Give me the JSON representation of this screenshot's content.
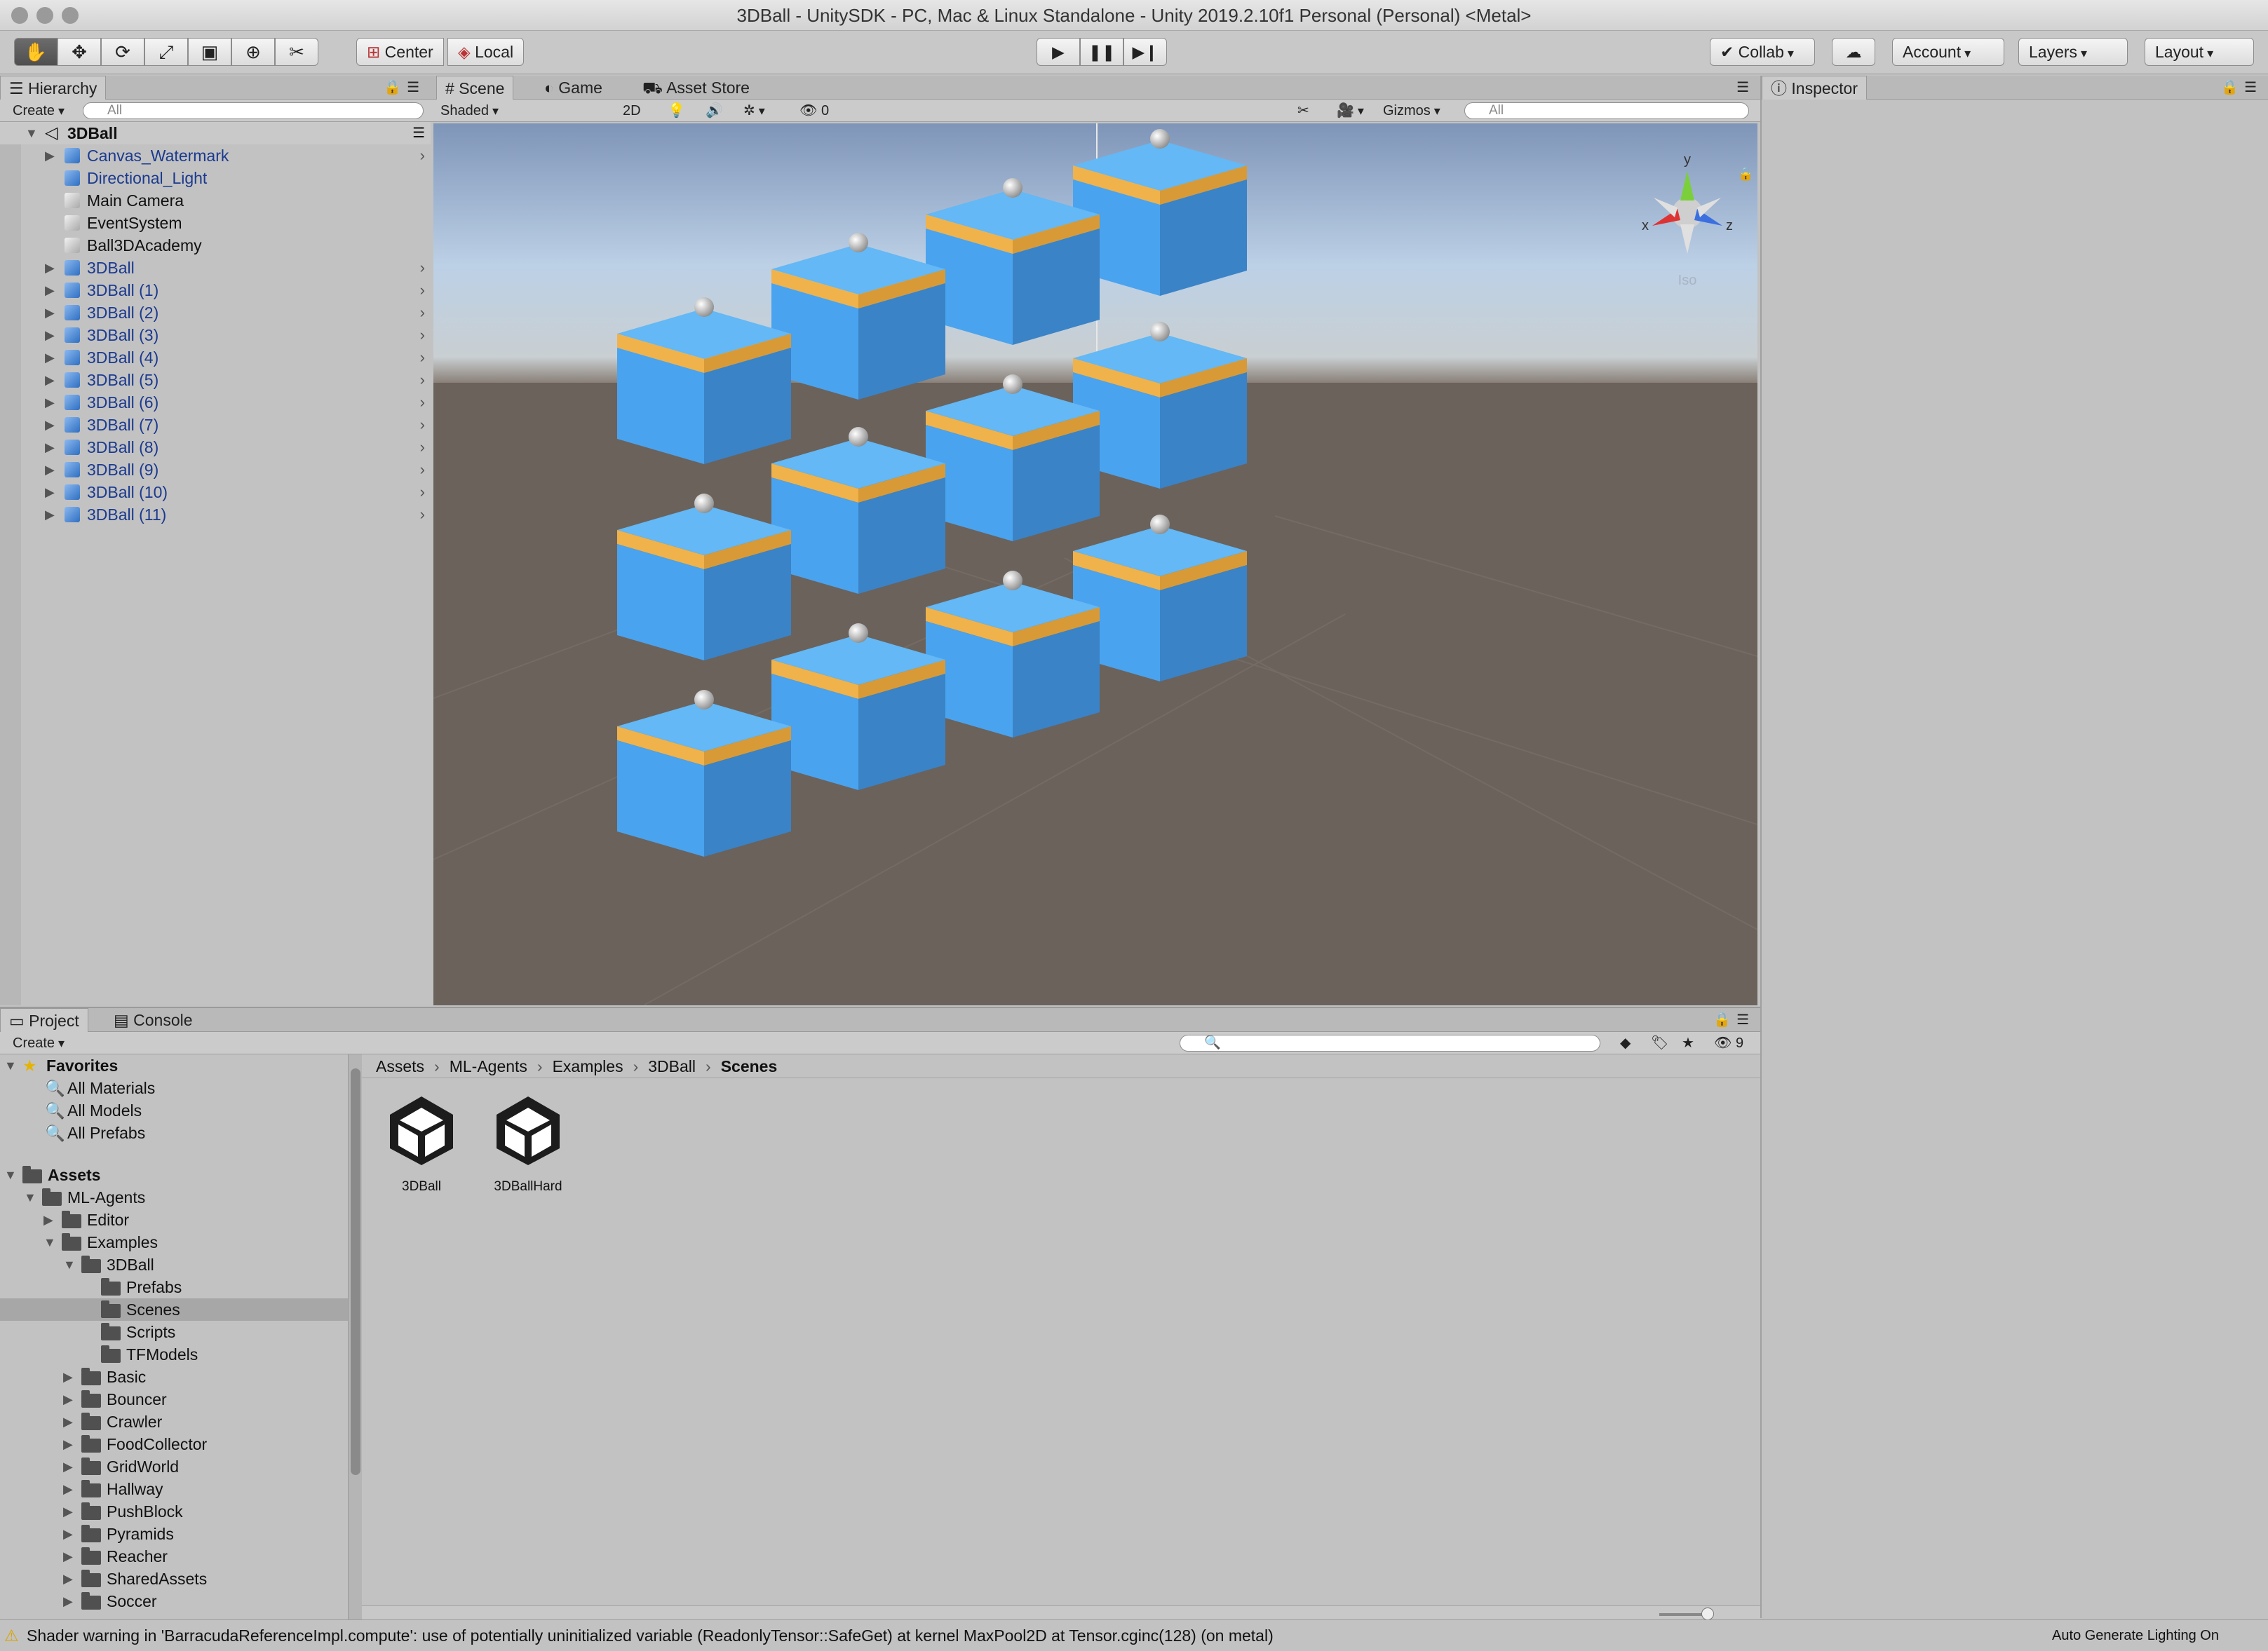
{
  "window": {
    "title": "3DBall - UnitySDK - PC, Mac & Linux Standalone - Unity 2019.2.10f1 Personal (Personal) <Metal>"
  },
  "toolbar": {
    "tools": [
      "hand-tool",
      "move-tool",
      "rotate-tool",
      "scale-tool",
      "rect-tool",
      "transform-tool",
      "custom-tool"
    ],
    "pivot_label": "Center",
    "space_label": "Local",
    "collab_label": "Collab",
    "account_label": "Account",
    "layers_label": "Layers",
    "layout_label": "Layout"
  },
  "hierarchy": {
    "tab_label": "Hierarchy",
    "create_label": "Create",
    "search_placeholder": "All",
    "scene_name": "3DBall",
    "items": [
      {
        "label": "Canvas_Watermark",
        "prefab": true,
        "expandable": true
      },
      {
        "label": "Directional_Light",
        "prefab": true,
        "expandable": false
      },
      {
        "label": "Main Camera",
        "prefab": false,
        "expandable": false
      },
      {
        "label": "EventSystem",
        "prefab": false,
        "expandable": false
      },
      {
        "label": "Ball3DAcademy",
        "prefab": false,
        "expandable": false
      },
      {
        "label": "3DBall",
        "prefab": true,
        "expandable": true
      },
      {
        "label": "3DBall (1)",
        "prefab": true,
        "expandable": true
      },
      {
        "label": "3DBall (2)",
        "prefab": true,
        "expandable": true
      },
      {
        "label": "3DBall (3)",
        "prefab": true,
        "expandable": true
      },
      {
        "label": "3DBall (4)",
        "prefab": true,
        "expandable": true
      },
      {
        "label": "3DBall (5)",
        "prefab": true,
        "expandable": true
      },
      {
        "label": "3DBall (6)",
        "prefab": true,
        "expandable": true
      },
      {
        "label": "3DBall (7)",
        "prefab": true,
        "expandable": true
      },
      {
        "label": "3DBall (8)",
        "prefab": true,
        "expandable": true
      },
      {
        "label": "3DBall (9)",
        "prefab": true,
        "expandable": true
      },
      {
        "label": "3DBall (10)",
        "prefab": true,
        "expandable": true
      },
      {
        "label": "3DBall (11)",
        "prefab": true,
        "expandable": true
      }
    ]
  },
  "scene": {
    "tabs": [
      "Scene",
      "Game",
      "Asset Store"
    ],
    "shading_mode": "Shaded",
    "mode_2d": "2D",
    "hidden_count": "0",
    "gizmos_label": "Gizmos",
    "search_placeholder": "All",
    "gizmo_labels": {
      "y": "y",
      "x": "x",
      "z": "z",
      "projection": "Iso"
    }
  },
  "inspector": {
    "tab_label": "Inspector"
  },
  "project": {
    "tabs": [
      "Project",
      "Console"
    ],
    "create_label": "Create",
    "hidden_count": "9",
    "favorites_label": "Favorites",
    "favorites": [
      "All Materials",
      "All Models",
      "All Prefabs"
    ],
    "tree": [
      {
        "label": "Assets",
        "depth": 0,
        "bold": true,
        "expanded": true
      },
      {
        "label": "ML-Agents",
        "depth": 1,
        "expanded": true
      },
      {
        "label": "Editor",
        "depth": 2,
        "collapsed": true
      },
      {
        "label": "Examples",
        "depth": 2,
        "expanded": true
      },
      {
        "label": "3DBall",
        "depth": 3,
        "expanded": true
      },
      {
        "label": "Prefabs",
        "depth": 4
      },
      {
        "label": "Scenes",
        "depth": 4,
        "selected": true
      },
      {
        "label": "Scripts",
        "depth": 4
      },
      {
        "label": "TFModels",
        "depth": 4
      },
      {
        "label": "Basic",
        "depth": 3,
        "collapsed": true
      },
      {
        "label": "Bouncer",
        "depth": 3,
        "collapsed": true
      },
      {
        "label": "Crawler",
        "depth": 3,
        "collapsed": true
      },
      {
        "label": "FoodCollector",
        "depth": 3,
        "collapsed": true
      },
      {
        "label": "GridWorld",
        "depth": 3,
        "collapsed": true
      },
      {
        "label": "Hallway",
        "depth": 3,
        "collapsed": true
      },
      {
        "label": "PushBlock",
        "depth": 3,
        "collapsed": true
      },
      {
        "label": "Pyramids",
        "depth": 3,
        "collapsed": true
      },
      {
        "label": "Reacher",
        "depth": 3,
        "collapsed": true
      },
      {
        "label": "SharedAssets",
        "depth": 3,
        "collapsed": true
      },
      {
        "label": "Soccer",
        "depth": 3,
        "collapsed": true
      }
    ],
    "breadcrumb": [
      "Assets",
      "ML-Agents",
      "Examples",
      "3DBall",
      "Scenes"
    ],
    "assets": [
      "3DBall",
      "3DBallHard"
    ]
  },
  "status": {
    "message": "Shader warning in 'BarracudaReferenceImpl.compute': use of potentially uninitialized variable (ReadonlyTensor::SafeGet) at kernel MaxPool2D at Tensor.cginc(128) (on metal)",
    "lighting": "Auto Generate Lighting On"
  },
  "colors": {
    "cube_blue": "#4aa3ee",
    "cube_stripe": "#f0b24a",
    "ground": "#6b625c",
    "prefab_text": "#1b3a8f"
  }
}
